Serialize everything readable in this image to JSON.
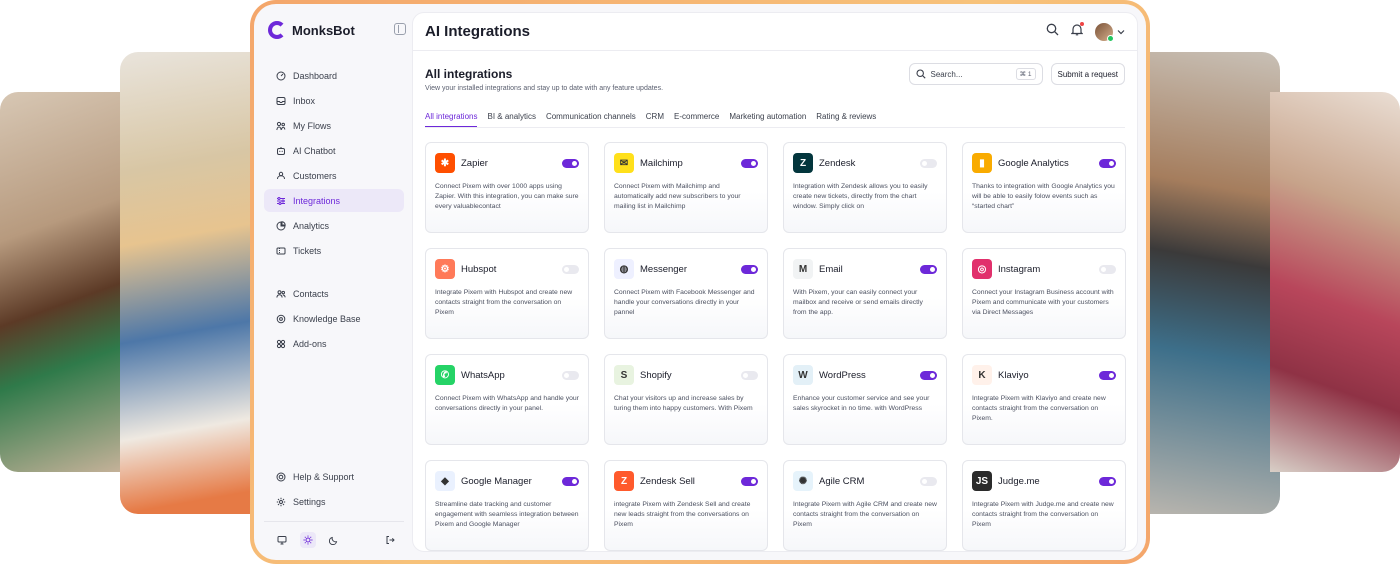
{
  "app": {
    "brand": "MonksBot",
    "page_title": "AI Integrations"
  },
  "colors": {
    "accent": "#6d28d9",
    "frame_gradient": "#f4a66b"
  },
  "sidebar": {
    "items": [
      {
        "label": "Dashboard",
        "icon": "dashboard-icon"
      },
      {
        "label": "Inbox",
        "icon": "inbox-icon"
      },
      {
        "label": "My Flows",
        "icon": "flows-icon"
      },
      {
        "label": "AI Chatbot",
        "icon": "chatbot-icon"
      },
      {
        "label": "Customers",
        "icon": "customers-icon"
      },
      {
        "label": "Integrations",
        "icon": "integrations-icon",
        "active": true
      },
      {
        "label": "Analytics",
        "icon": "analytics-icon"
      },
      {
        "label": "Tickets",
        "icon": "tickets-icon"
      }
    ],
    "items2": [
      {
        "label": "Contacts",
        "icon": "contacts-icon"
      },
      {
        "label": "Knowledge Base",
        "icon": "knowledge-icon"
      },
      {
        "label": "Add-ons",
        "icon": "addons-icon"
      }
    ],
    "bottom": [
      {
        "label": "Help & Support",
        "icon": "help-icon"
      },
      {
        "label": "Settings",
        "icon": "settings-icon"
      }
    ],
    "theme_active": "light"
  },
  "main": {
    "section_title": "All integrations",
    "section_subtitle": "View your installed integrations and stay up to date with any feature updates.",
    "search": {
      "placeholder": "Search...",
      "shortcut": "⌘ 1"
    },
    "submit_label": "Submit a request",
    "tabs": [
      "All integrations",
      "BI & analytics",
      "Communication channels",
      "CRM",
      "E-commerce",
      "Marketing automation",
      "Rating & reviews"
    ],
    "active_tab": 0
  },
  "integrations": [
    {
      "name": "Zapier",
      "enabled": true,
      "logo_color": "#ff4f00",
      "logo_glyph": "✱",
      "desc": "Connect Pixem with over 1000 apps using Zapier. With this integration, you can make sure every valuablecontact"
    },
    {
      "name": "Mailchimp",
      "enabled": true,
      "logo_color": "#ffe01b",
      "logo_glyph": "✉",
      "desc": "Connect Pixem with Mailchimp and automatically add new subscribers to your mailing list in Mailchimp"
    },
    {
      "name": "Zendesk",
      "enabled": false,
      "logo_color": "#03363d",
      "logo_glyph": "Z",
      "desc": "Integration with Zendesk allows you to easily create new tickets, directly from the chart window. Simply click on"
    },
    {
      "name": "Google Analytics",
      "enabled": true,
      "logo_color": "#f9ab00",
      "logo_glyph": "▮",
      "desc": "Thanks to integration with Google Analytics you will be able to easily folow events such as “started chart”"
    },
    {
      "name": "Hubspot",
      "enabled": false,
      "logo_color": "#ff7a59",
      "logo_glyph": "⚙",
      "desc": "Integrate Pixem with Hubspot and create new contacts straight from the conversation on Pixem"
    },
    {
      "name": "Messenger",
      "enabled": true,
      "logo_color": "#eef0ff",
      "logo_glyph": "◍",
      "desc": "Connect Pixem with Facebook Messenger and handle your conversations directly in your pannel"
    },
    {
      "name": "Email",
      "enabled": true,
      "logo_color": "#f1f3f4",
      "logo_glyph": "M",
      "desc": "With Pixem, your can easily connect your mailbox and receive or send emails directly from the app."
    },
    {
      "name": "Instagram",
      "enabled": false,
      "logo_color": "#e1306c",
      "logo_glyph": "◎",
      "desc": "Connect your Instagram Business account with Pixem and communicate with your customers via Direct Messages"
    },
    {
      "name": "WhatsApp",
      "enabled": false,
      "logo_color": "#25d366",
      "logo_glyph": "✆",
      "desc": "Connect Pixem with WhatsApp and handle your conversations directly in your panel."
    },
    {
      "name": "Shopify",
      "enabled": false,
      "logo_color": "#e8f3e0",
      "logo_glyph": "S",
      "desc": "Chat your visitors up and increase sales by turing them into happy customers. With Pixem"
    },
    {
      "name": "WordPress",
      "enabled": true,
      "logo_color": "#e3f0f7",
      "logo_glyph": "W",
      "desc": "Enhance your customer service and see your sales skyrocket in no time. with WordPress"
    },
    {
      "name": "Klaviyo",
      "enabled": true,
      "logo_color": "#fff1ea",
      "logo_glyph": "K",
      "desc": "Integrate Pixem with Klaviyo and create new contacts straight from the conversation on Pixem."
    },
    {
      "name": "Google Manager",
      "enabled": true,
      "logo_color": "#eaf1fe",
      "logo_glyph": "◆",
      "desc": "Streamline date tracking and customer engagement with seamless integration between Pixem and Google Manager"
    },
    {
      "name": "Zendesk Sell",
      "enabled": true,
      "logo_color": "#ff5a2c",
      "logo_glyph": "Z",
      "desc": "integrate Pixem with Zendesk Sell and create new leads straight from the conversations on Pixem"
    },
    {
      "name": "Agile CRM",
      "enabled": false,
      "logo_color": "#e6f3fb",
      "logo_glyph": "✺",
      "desc": "Integrate Pixem with Agile CRM and create new contacts straight from the conversation on Pixem"
    },
    {
      "name": "Judge.me",
      "enabled": true,
      "logo_color": "#2b2b2b",
      "logo_glyph": "JS",
      "desc": "Integrate Pixem with Judge.me and create new contacts straight from the conversation on Pixem"
    }
  ]
}
